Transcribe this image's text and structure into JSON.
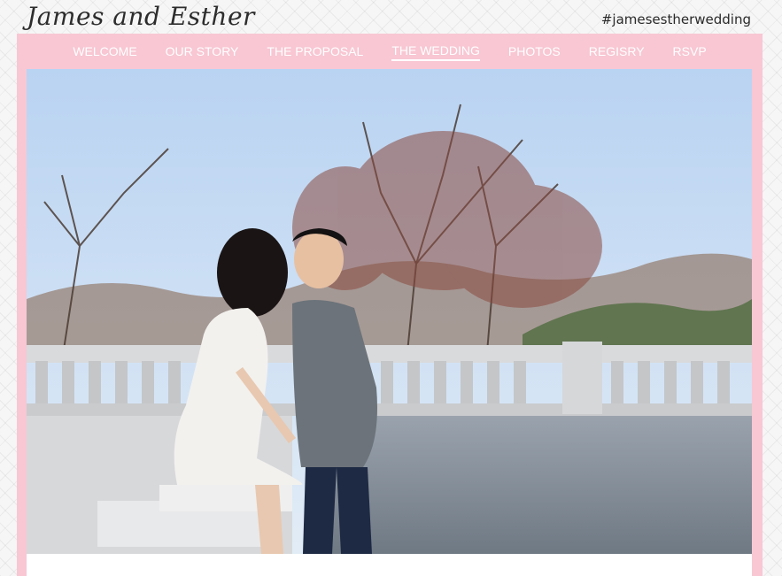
{
  "header": {
    "logo_text": "James and Esther",
    "hashtag": "#jamesestherwedding"
  },
  "nav": {
    "items": [
      {
        "label": "WELCOME"
      },
      {
        "label": "OUR STORY"
      },
      {
        "label": "THE PROPOSAL"
      },
      {
        "label": "THE WEDDING"
      },
      {
        "label": "PHOTOS"
      },
      {
        "label": "REGISRY"
      },
      {
        "label": "RSVP"
      }
    ],
    "active": "THE WEDDING"
  },
  "hero": {
    "image": "couple-kissing-on-balustrade-photo"
  },
  "colors": {
    "frame_pink": "#f8c7d3",
    "nav_text": "#ffffff",
    "sky": "#cfe0f3"
  }
}
